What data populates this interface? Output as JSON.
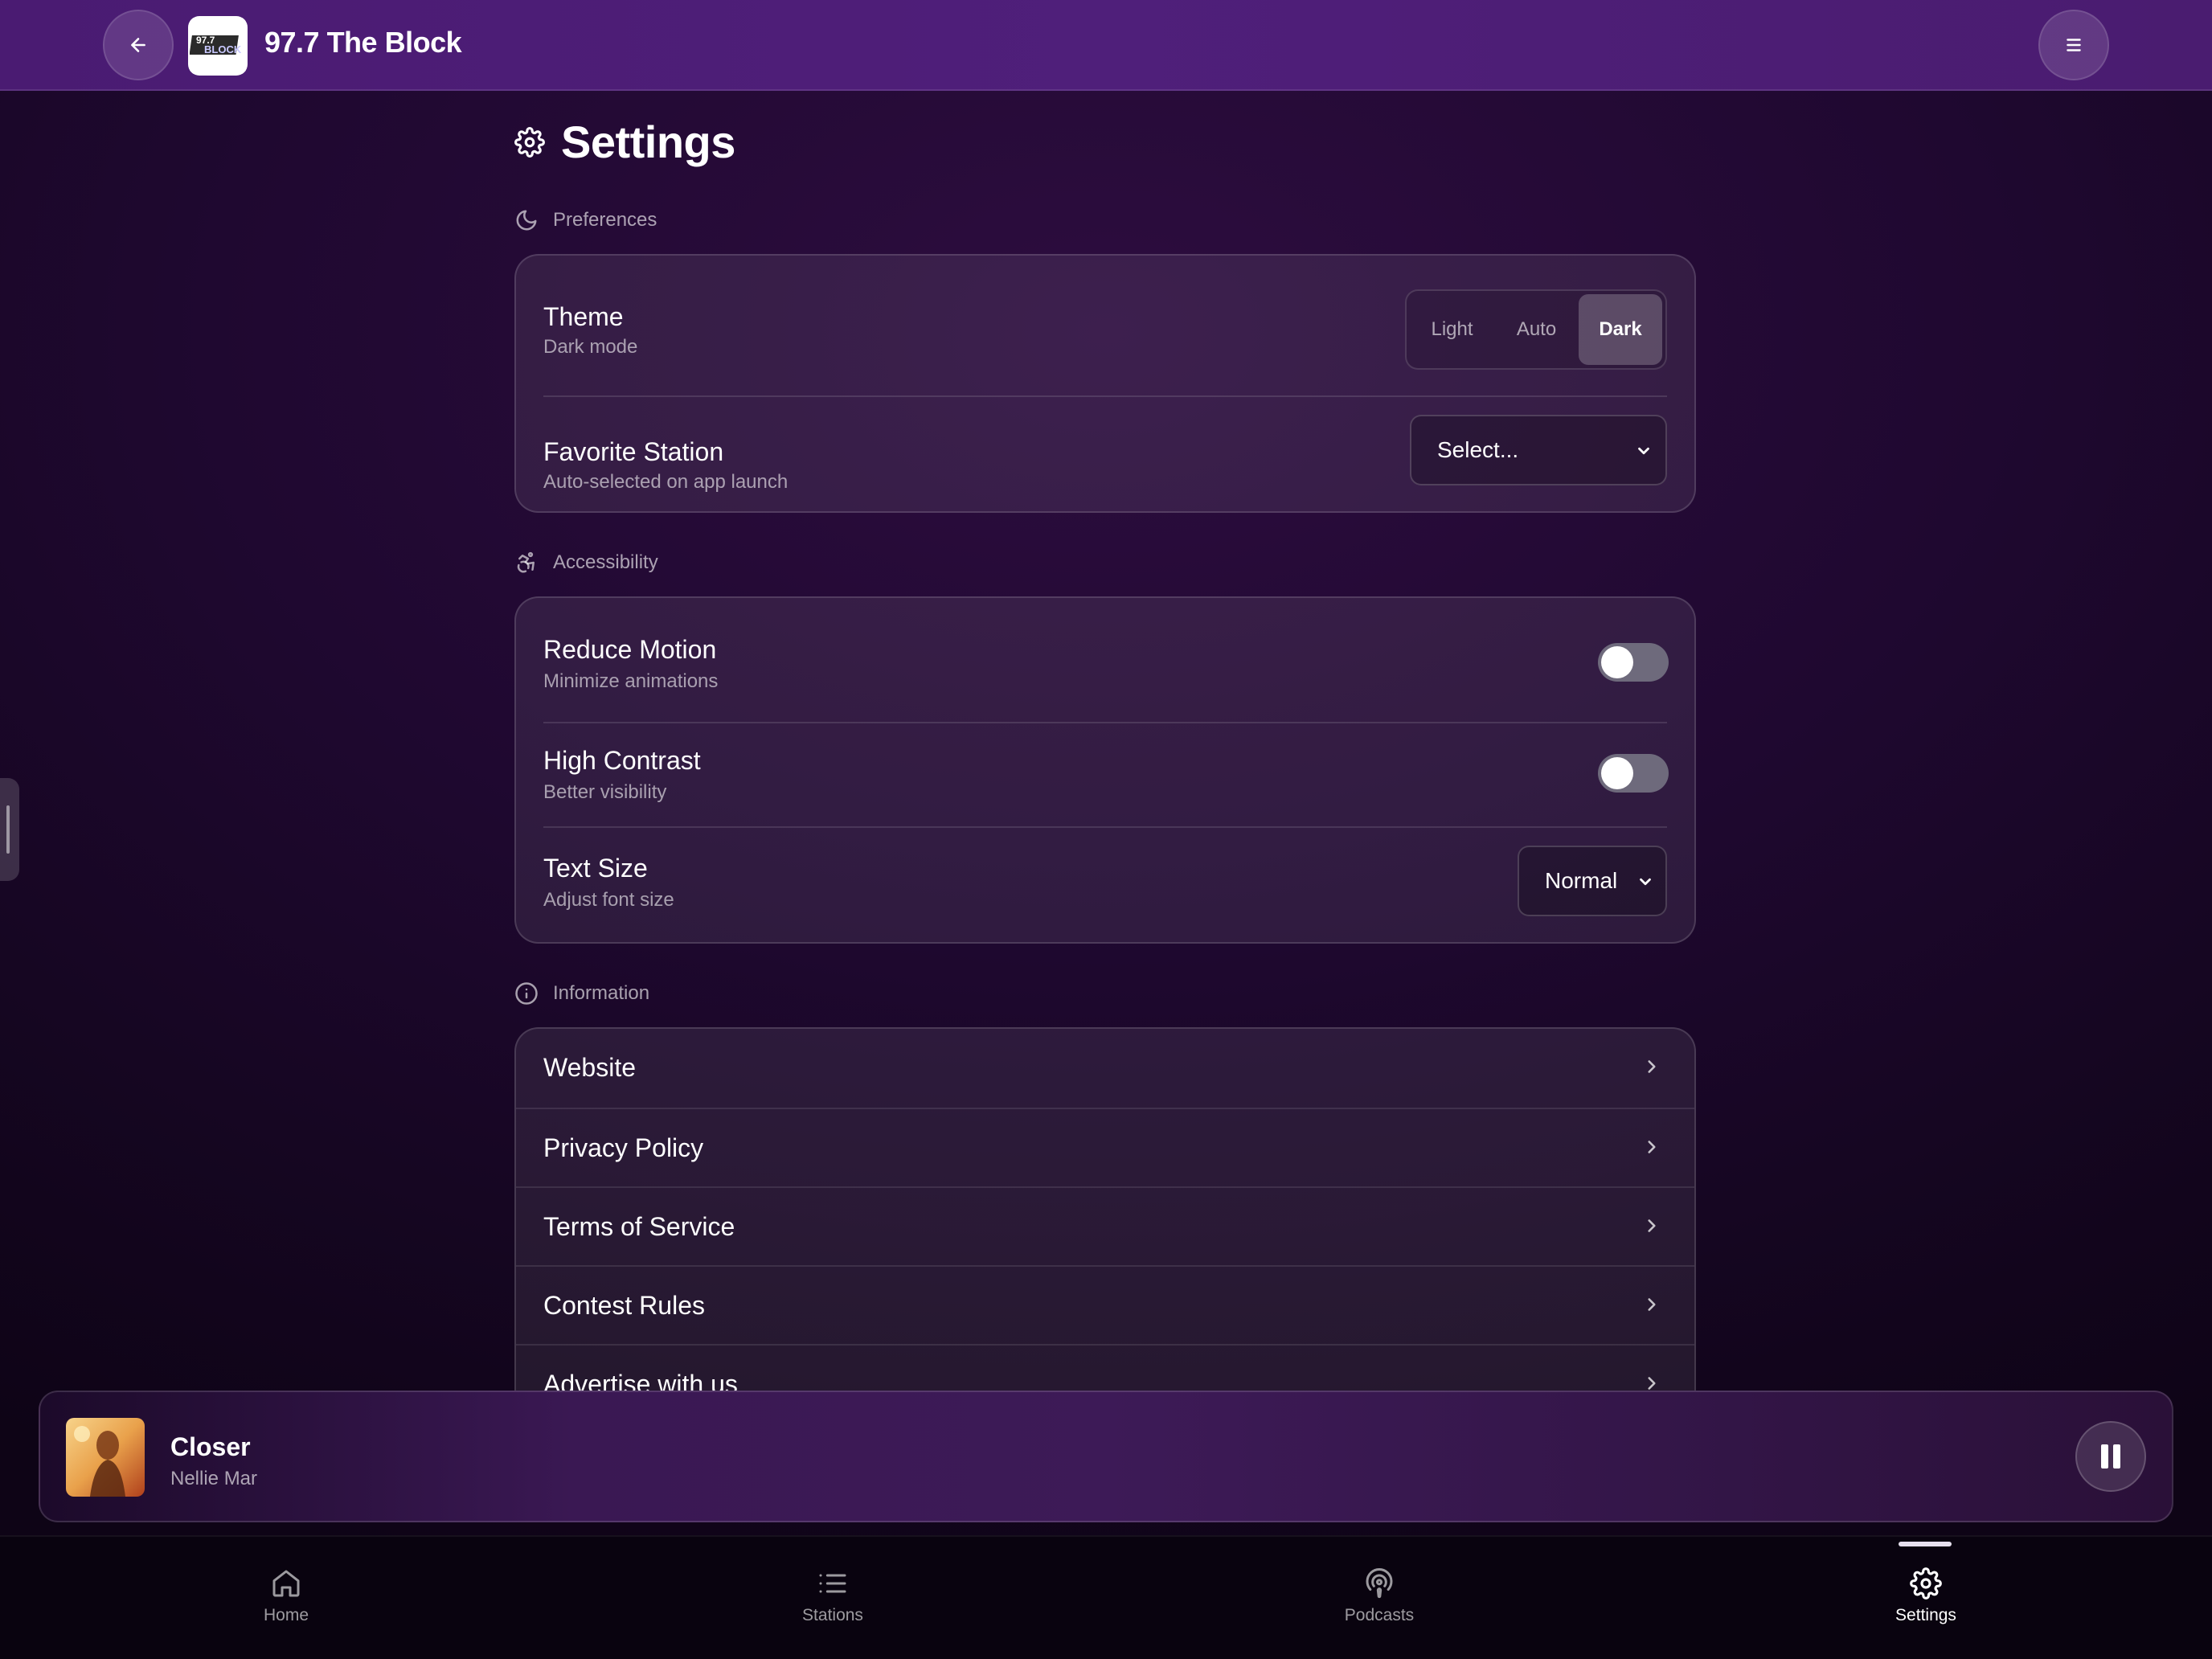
{
  "header": {
    "app_title": "97.7 The Block",
    "logo_text_top": "97.7",
    "logo_text_bottom": "BLOCK",
    "back_icon": "arrow-left-icon",
    "menu_icon": "hamburger-menu-icon"
  },
  "page": {
    "title": "Settings",
    "title_icon": "gear-icon"
  },
  "preferences": {
    "section_label": "Preferences",
    "section_icon": "moon-icon",
    "theme": {
      "title": "Theme",
      "subtitle": "Dark mode",
      "options": [
        "Light",
        "Auto",
        "Dark"
      ],
      "selected": "Dark"
    },
    "favorite_station": {
      "title": "Favorite Station",
      "subtitle": "Auto-selected on app launch",
      "value": "Select..."
    }
  },
  "accessibility": {
    "section_label": "Accessibility",
    "section_icon": "accessibility-icon",
    "reduce_motion": {
      "title": "Reduce Motion",
      "subtitle": "Minimize animations",
      "enabled": false
    },
    "high_contrast": {
      "title": "High Contrast",
      "subtitle": "Better visibility",
      "enabled": false
    },
    "text_size": {
      "title": "Text Size",
      "subtitle": "Adjust font size",
      "value": "Normal"
    }
  },
  "information": {
    "section_label": "Information",
    "section_icon": "info-icon",
    "links": [
      "Website",
      "Privacy Policy",
      "Terms of Service",
      "Contest Rules",
      "Advertise with us"
    ]
  },
  "player": {
    "track_title": "Closer",
    "artist": "Nellie Mar",
    "state": "playing",
    "control_icon": "pause-icon"
  },
  "bottom_nav": {
    "items": [
      {
        "label": "Home",
        "icon": "home-icon"
      },
      {
        "label": "Stations",
        "icon": "list-icon"
      },
      {
        "label": "Podcasts",
        "icon": "podcast-icon"
      },
      {
        "label": "Settings",
        "icon": "gear-icon"
      }
    ],
    "active": "Settings"
  },
  "colors": {
    "header_bg": "#4f1f7a",
    "page_bg": "#1f0830",
    "toggle_off": "#6e6a7c",
    "nav_bg": "#09030f"
  }
}
